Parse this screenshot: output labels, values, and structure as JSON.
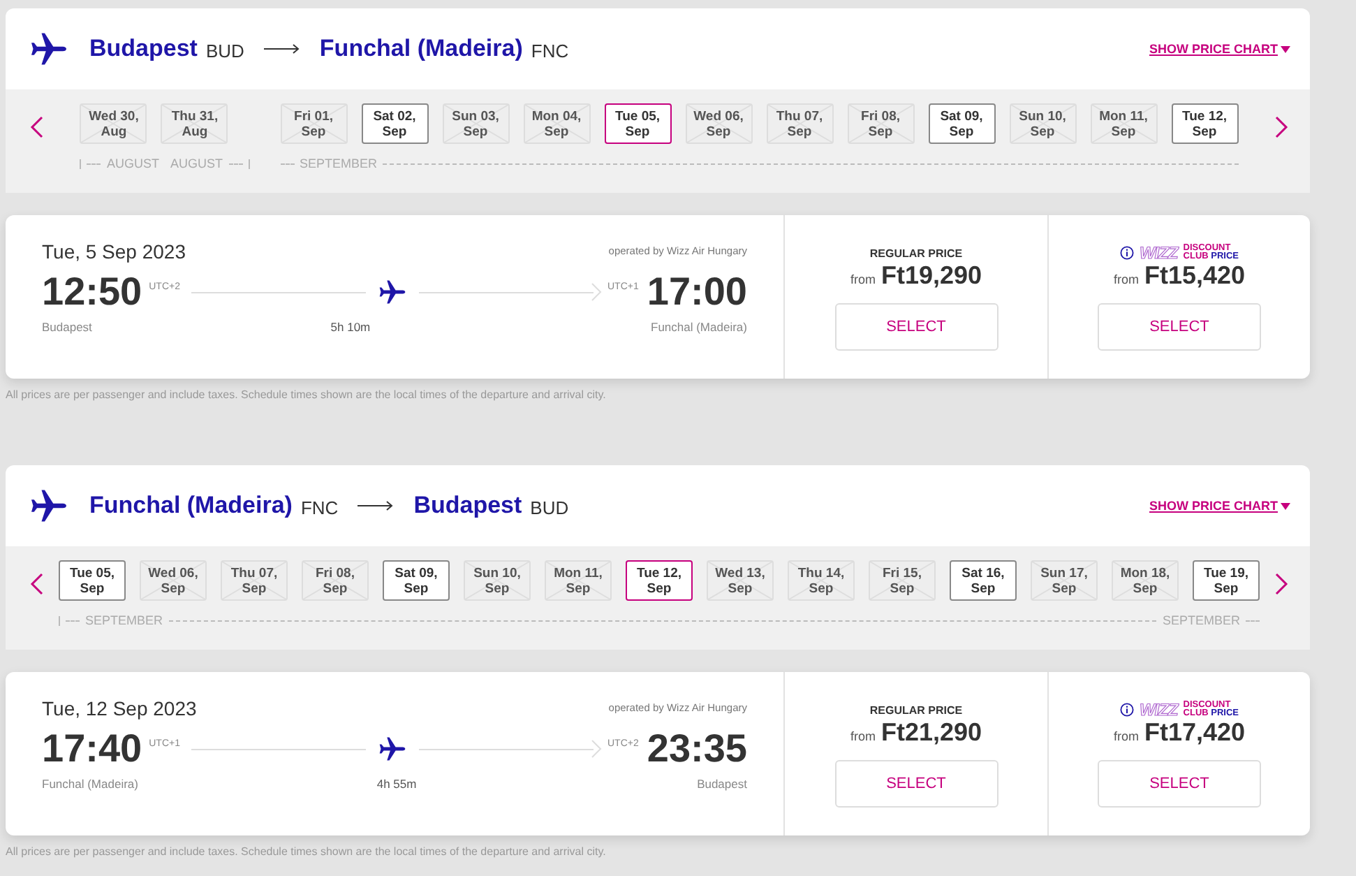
{
  "journeys": [
    {
      "route": {
        "from_city": "Budapest",
        "from_code": "BUD",
        "to_city": "Funchal (Madeira)",
        "to_code": "FNC"
      },
      "price_chart_link": "SHOW PRICE CHART",
      "months": [
        {
          "labels": [
            "AUGUST",
            "AUGUST"
          ],
          "days": [
            {
              "day": "Wed 30,",
              "month": "Aug",
              "available": false,
              "selected": false
            },
            {
              "day": "Thu 31,",
              "month": "Aug",
              "available": false,
              "selected": false
            }
          ]
        },
        {
          "labels": [
            "SEPTEMBER"
          ],
          "days": [
            {
              "day": "Fri 01,",
              "month": "Sep",
              "available": false,
              "selected": false
            },
            {
              "day": "Sat 02,",
              "month": "Sep",
              "available": true,
              "selected": false
            },
            {
              "day": "Sun 03,",
              "month": "Sep",
              "available": false,
              "selected": false
            },
            {
              "day": "Mon 04,",
              "month": "Sep",
              "available": false,
              "selected": false
            },
            {
              "day": "Tue 05,",
              "month": "Sep",
              "available": true,
              "selected": true
            },
            {
              "day": "Wed 06,",
              "month": "Sep",
              "available": false,
              "selected": false
            },
            {
              "day": "Thu 07,",
              "month": "Sep",
              "available": false,
              "selected": false
            },
            {
              "day": "Fri 08,",
              "month": "Sep",
              "available": false,
              "selected": false
            },
            {
              "day": "Sat 09,",
              "month": "Sep",
              "available": true,
              "selected": false
            },
            {
              "day": "Sun 10,",
              "month": "Sep",
              "available": false,
              "selected": false
            },
            {
              "day": "Mon 11,",
              "month": "Sep",
              "available": false,
              "selected": false
            },
            {
              "day": "Tue 12,",
              "month": "Sep",
              "available": true,
              "selected": false
            }
          ]
        }
      ],
      "flight": {
        "date": "Tue, 5 Sep 2023",
        "operator": "operated by Wizz Air Hungary",
        "dep_time": "12:50",
        "dep_tz": "UTC+2",
        "dep_city": "Budapest",
        "duration": "5h 10m",
        "arr_tz": "UTC+1",
        "arr_time": "17:00",
        "arr_city": "Funchal (Madeira)"
      },
      "fares": [
        {
          "kind": "regular",
          "title": "REGULAR PRICE",
          "from": "from",
          "price": "Ft19,290",
          "button": "SELECT"
        },
        {
          "kind": "club",
          "logo": "WIZZ",
          "title_top": "DISCOUNT",
          "title_bottom_a": "CLUB",
          "title_bottom_b": "PRICE",
          "from": "from",
          "price": "Ft15,420",
          "button": "SELECT"
        }
      ],
      "note": "All prices are per passenger and include taxes. Schedule times shown are the local times of the departure and arrival city."
    },
    {
      "route": {
        "from_city": "Funchal (Madeira)",
        "from_code": "FNC",
        "to_city": "Budapest",
        "to_code": "BUD"
      },
      "price_chart_link": "SHOW PRICE CHART",
      "months": [
        {
          "labels": [
            "SEPTEMBER",
            "SEPTEMBER"
          ],
          "days": [
            {
              "day": "Tue 05,",
              "month": "Sep",
              "available": true,
              "selected": false
            },
            {
              "day": "Wed 06,",
              "month": "Sep",
              "available": false,
              "selected": false
            },
            {
              "day": "Thu 07,",
              "month": "Sep",
              "available": false,
              "selected": false
            },
            {
              "day": "Fri 08,",
              "month": "Sep",
              "available": false,
              "selected": false
            },
            {
              "day": "Sat 09,",
              "month": "Sep",
              "available": true,
              "selected": false
            },
            {
              "day": "Sun 10,",
              "month": "Sep",
              "available": false,
              "selected": false
            },
            {
              "day": "Mon 11,",
              "month": "Sep",
              "available": false,
              "selected": false
            },
            {
              "day": "Tue 12,",
              "month": "Sep",
              "available": true,
              "selected": true
            },
            {
              "day": "Wed 13,",
              "month": "Sep",
              "available": false,
              "selected": false
            },
            {
              "day": "Thu 14,",
              "month": "Sep",
              "available": false,
              "selected": false
            },
            {
              "day": "Fri 15,",
              "month": "Sep",
              "available": false,
              "selected": false
            },
            {
              "day": "Sat 16,",
              "month": "Sep",
              "available": true,
              "selected": false
            },
            {
              "day": "Sun 17,",
              "month": "Sep",
              "available": false,
              "selected": false
            },
            {
              "day": "Mon 18,",
              "month": "Sep",
              "available": false,
              "selected": false
            },
            {
              "day": "Tue 19,",
              "month": "Sep",
              "available": true,
              "selected": false
            }
          ]
        }
      ],
      "flight": {
        "date": "Tue, 12 Sep 2023",
        "operator": "operated by Wizz Air Hungary",
        "dep_time": "17:40",
        "dep_tz": "UTC+1",
        "dep_city": "Funchal (Madeira)",
        "duration": "4h 55m",
        "arr_tz": "UTC+2",
        "arr_time": "23:35",
        "arr_city": "Budapest"
      },
      "fares": [
        {
          "kind": "regular",
          "title": "REGULAR PRICE",
          "from": "from",
          "price": "Ft21,290",
          "button": "SELECT"
        },
        {
          "kind": "club",
          "logo": "WIZZ",
          "title_top": "DISCOUNT",
          "title_bottom_a": "CLUB",
          "title_bottom_b": "PRICE",
          "from": "from",
          "price": "Ft17,420",
          "button": "SELECT"
        }
      ],
      "note": "All prices are per passenger and include taxes. Schedule times shown are the local times of the departure and arrival city."
    }
  ]
}
